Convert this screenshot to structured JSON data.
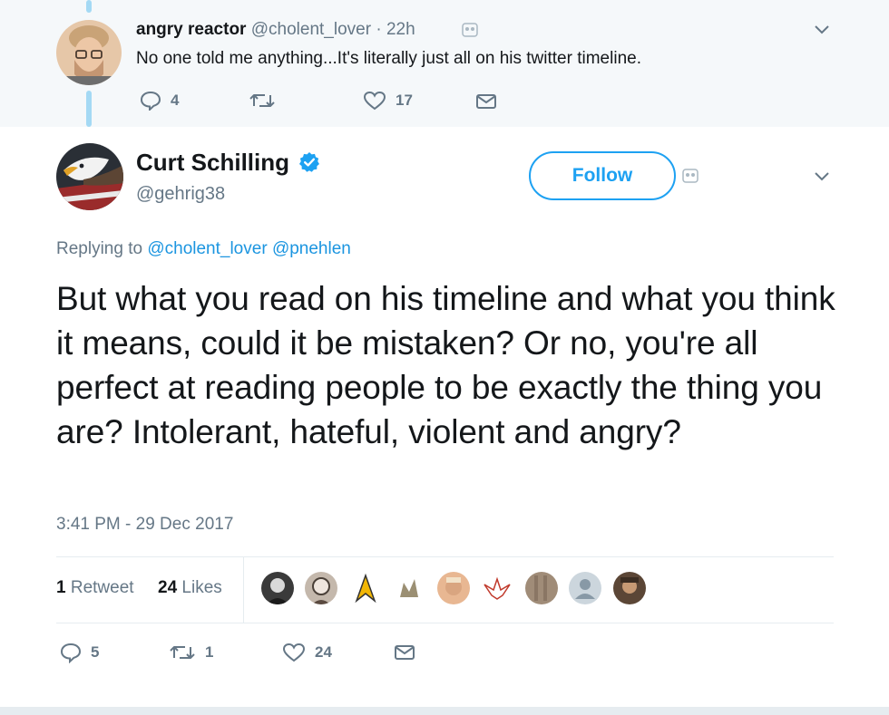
{
  "parent_tweet": {
    "display_name": "angry reactor",
    "handle": "@cholent_lover",
    "separator": "·",
    "time": "22h",
    "text": "No one told me anything...It's literally just all on his twitter timeline.",
    "reply_count": "4",
    "retweet_count": "",
    "like_count": "17"
  },
  "main_tweet": {
    "display_name": "Curt Schilling",
    "handle": "@gehrig38",
    "follow_label": "Follow",
    "replying_prefix": "Replying to",
    "replying_to": [
      "@cholent_lover",
      "@pnehlen"
    ],
    "text": "But what you read on his timeline and what you think it means, could it be mistaken? Or no, you're all perfect at reading people to be exactly the thing you are? Intolerant, hateful, violent and angry?",
    "timestamp": "3:41 PM - 29 Dec 2017",
    "stats": {
      "retweets_count": "1",
      "retweets_label": "Retweet",
      "likes_count": "24",
      "likes_label": "Likes"
    },
    "actions": {
      "reply_count": "5",
      "retweet_count": "1",
      "like_count": "24"
    }
  },
  "colors": {
    "accent": "#1da1f2",
    "link": "#1b95e0",
    "muted": "#657786",
    "parent_bg": "#f5f8fa",
    "thread_line": "#a4d9f4"
  },
  "icons": [
    "reply-icon",
    "retweet-icon",
    "heart-icon",
    "mail-icon",
    "chevron-down-icon",
    "verified-badge-icon",
    "block-icon"
  ]
}
